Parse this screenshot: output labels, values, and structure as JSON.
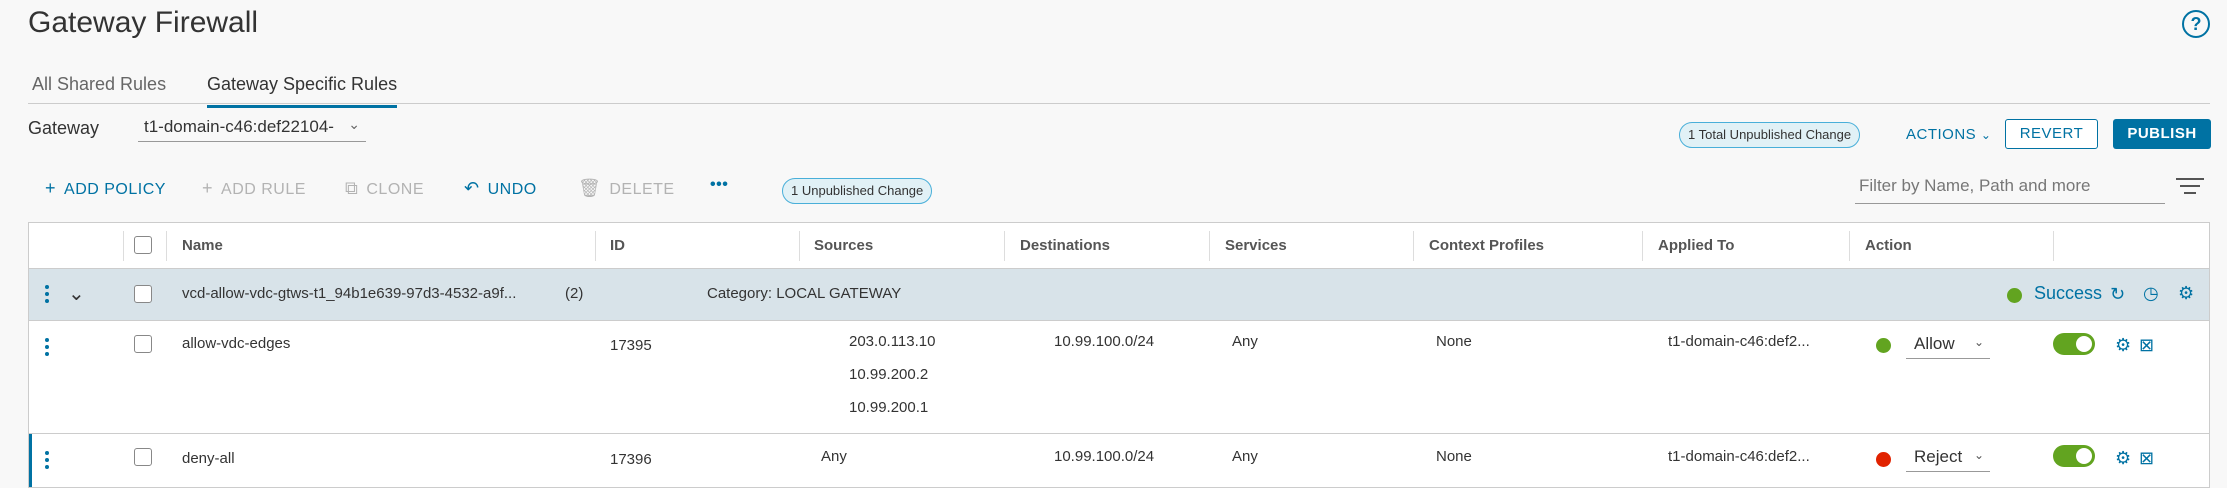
{
  "header": {
    "title": "Gateway Firewall",
    "help_icon": "?"
  },
  "tabs": [
    {
      "label": "All Shared Rules",
      "active": false
    },
    {
      "label": "Gateway Specific Rules",
      "active": true
    }
  ],
  "gateway": {
    "label": "Gateway",
    "value": "t1-domain-c46:def22104-"
  },
  "top_actions": {
    "unpublished_total": "1 Total Unpublished Change",
    "actions_label": "ACTIONS",
    "revert_label": "REVERT",
    "publish_label": "PUBLISH"
  },
  "toolbar": {
    "add_policy": "ADD POLICY",
    "add_rule": "ADD RULE",
    "clone": "CLONE",
    "undo": "UNDO",
    "delete": "DELETE",
    "more": "•••",
    "unpublished_badge": "1 Unpublished Change",
    "filter_placeholder": "Filter by Name, Path and more"
  },
  "columns": [
    "Name",
    "ID",
    "Sources",
    "Destinations",
    "Services",
    "Context Profiles",
    "Applied To",
    "Action"
  ],
  "policy": {
    "name": "vcd-allow-vdc-gtws-t1_94b1e639-97d3-4532-a9f...",
    "count": "(2)",
    "category": "Category: LOCAL GATEWAY",
    "status": "Success",
    "status_color": "#62a420"
  },
  "rules": [
    {
      "name": "allow-vdc-edges",
      "id": "17395",
      "sources": [
        "203.0.113.10",
        "10.99.200.2",
        "10.99.200.1"
      ],
      "destinations": "10.99.100.0/24",
      "services": "Any",
      "context_profiles": "None",
      "applied_to": "t1-domain-c46:def2...",
      "action": "Allow",
      "action_color": "#62a420",
      "enabled": true
    },
    {
      "name": "deny-all",
      "id": "17396",
      "sources": [
        "Any"
      ],
      "destinations": "10.99.100.0/24",
      "services": "Any",
      "context_profiles": "None",
      "applied_to": "t1-domain-c46:def2...",
      "action": "Reject",
      "action_color": "#e12200",
      "enabled": true
    }
  ]
}
